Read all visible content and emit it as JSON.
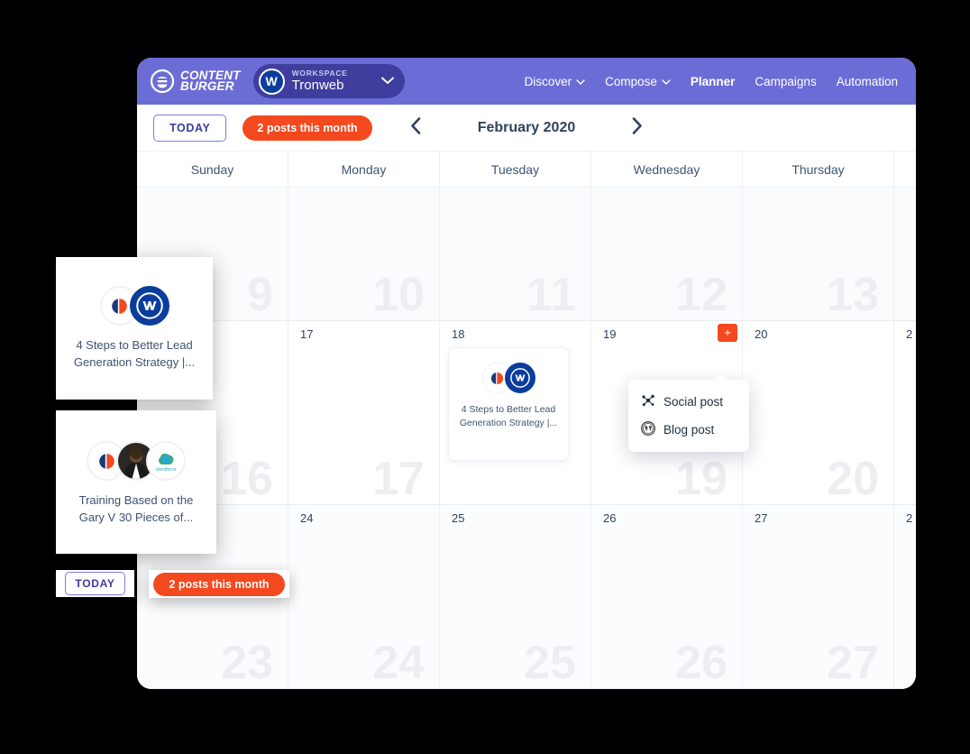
{
  "brand": {
    "line1": "CONTENT",
    "line2": "BURGER",
    "logo_icon": "content-burger-logo-icon"
  },
  "workspace": {
    "label": "WORKSPACE",
    "name": "Tronweb",
    "badge_letter": "W",
    "chevron_icon": "chevron-down-icon"
  },
  "nav": [
    {
      "label": "Discover",
      "has_caret": true,
      "active": false
    },
    {
      "label": "Compose",
      "has_caret": true,
      "active": false
    },
    {
      "label": "Planner",
      "has_caret": false,
      "active": true
    },
    {
      "label": "Campaigns",
      "has_caret": false,
      "active": false
    },
    {
      "label": "Automation",
      "has_caret": false,
      "active": false
    }
  ],
  "toolbar": {
    "today_label": "TODAY",
    "posts_pill": "2 posts this month",
    "prev_icon": "chevron-left-icon",
    "next_icon": "chevron-right-icon",
    "month_label": "February 2020"
  },
  "calendar": {
    "weekdays": [
      "Sunday",
      "Monday",
      "Tuesday",
      "Wednesday",
      "Thursday"
    ],
    "partial_column_visible": true,
    "weeks": [
      {
        "days": [
          {
            "num": "",
            "watermark": "9"
          },
          {
            "num": "",
            "watermark": "10"
          },
          {
            "num": "",
            "watermark": "11"
          },
          {
            "num": "",
            "watermark": "12"
          },
          {
            "num": "",
            "watermark": "13"
          },
          {
            "num": "",
            "watermark": ""
          }
        ]
      },
      {
        "days": [
          {
            "num": "",
            "watermark": "16"
          },
          {
            "num": "17",
            "watermark": "17"
          },
          {
            "num": "18",
            "watermark": ""
          },
          {
            "num": "19",
            "watermark": "19",
            "add_button": "+"
          },
          {
            "num": "20",
            "watermark": "20"
          },
          {
            "num": "2",
            "watermark": ""
          }
        ]
      },
      {
        "days": [
          {
            "num": "",
            "watermark": "23"
          },
          {
            "num": "24",
            "watermark": "24"
          },
          {
            "num": "25",
            "watermark": "25"
          },
          {
            "num": "26",
            "watermark": "26"
          },
          {
            "num": "27",
            "watermark": "27"
          },
          {
            "num": "2",
            "watermark": ""
          }
        ]
      }
    ]
  },
  "post_card": {
    "title": "4 Steps to Better Lead Generation Strategy |...",
    "avatars": [
      "network-icon",
      "tronweb-avatar"
    ]
  },
  "post_type_menu": {
    "items": [
      {
        "label": "Social post",
        "icon": "share-network-icon"
      },
      {
        "label": "Blog post",
        "icon": "wordpress-icon"
      }
    ]
  },
  "floating_cards": [
    {
      "title": "4 Steps to Better Lead Generation Strategy |...",
      "avatars": [
        "network-icon",
        "tronweb-avatar"
      ]
    },
    {
      "title": "Training Based on the Gary V 30 Pieces of...",
      "avatars": [
        "network-icon",
        "person-avatar",
        "clientforce-avatar"
      ]
    }
  ],
  "floating_buttons": {
    "today_label": "TODAY",
    "posts_pill": "2 posts this month"
  },
  "colors": {
    "header_purple": "#6C6CD6",
    "workspace_purple": "#3F3D9E",
    "accent_orange": "#F4481E",
    "text_slate": "#2F4260",
    "brand_blue": "#0A3D9C"
  }
}
